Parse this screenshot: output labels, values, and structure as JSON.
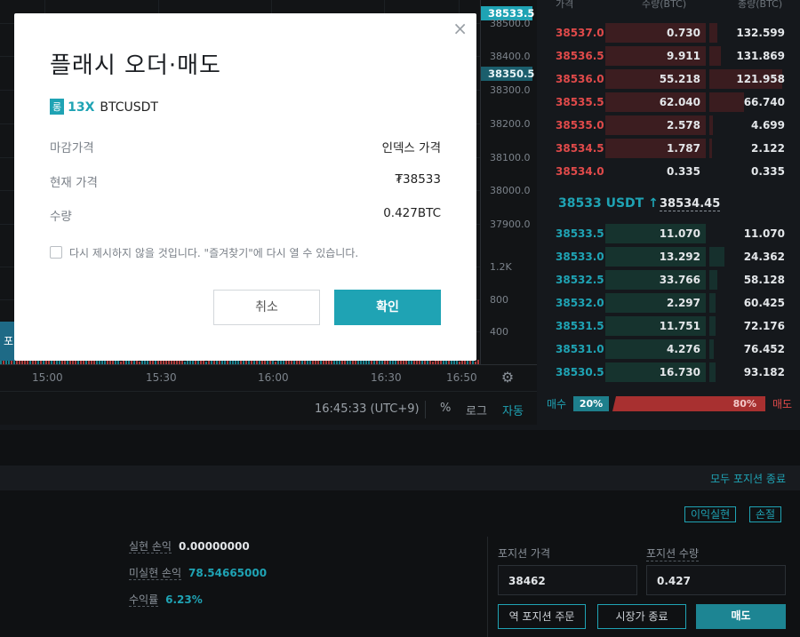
{
  "chart": {
    "price_ticks": [
      "38500.0",
      "38400.0",
      "38300.0",
      "38200.0",
      "38100.0",
      "38000.0",
      "37900.0"
    ],
    "volume_ticks": [
      "1.2K",
      "800",
      "400"
    ],
    "time_ticks": [
      "15:00",
      "15:30",
      "16:00",
      "16:30",
      "16:50"
    ],
    "tag_last": "38533.5",
    "tag_mark": "38350.5",
    "left_button_label": "포",
    "clock": "16:45:33 (UTC+9)",
    "toolbar": {
      "percent": "%",
      "log": "로그",
      "auto": "자동"
    },
    "colors": {
      "up": "#1fa3b4",
      "down": "#e04a4a"
    }
  },
  "orderbook": {
    "headers": {
      "price": "가격",
      "qty": "수량(BTC)",
      "total": "총량(BTC)"
    },
    "asks": [
      {
        "price": "38537.0",
        "qty": "0.730",
        "total": "132.599",
        "depth": 1.0,
        "mini": 0.1
      },
      {
        "price": "38536.5",
        "qty": "9.911",
        "total": "131.869",
        "depth": 1.0,
        "mini": 0.15
      },
      {
        "price": "38536.0",
        "qty": "55.218",
        "total": "121.958",
        "depth": 1.0,
        "mini": 0.95
      },
      {
        "price": "38535.5",
        "qty": "62.040",
        "total": "66.740",
        "depth": 1.0,
        "mini": 0.45
      },
      {
        "price": "38535.0",
        "qty": "2.578",
        "total": "4.699",
        "depth": 1.0,
        "mini": 0.05
      },
      {
        "price": "38534.5",
        "qty": "1.787",
        "total": "2.122",
        "depth": 1.0,
        "mini": 0.03
      },
      {
        "price": "38534.0",
        "qty": "0.335",
        "total": "0.335",
        "depth": 0.0,
        "mini": 0.0
      }
    ],
    "last_price": "38533 USDT",
    "arrow": "↑",
    "mark_price": "38534.45",
    "bids": [
      {
        "price": "38533.5",
        "qty": "11.070",
        "total": "11.070",
        "depth": 1.0,
        "mini": 0.0
      },
      {
        "price": "38533.0",
        "qty": "13.292",
        "total": "24.362",
        "depth": 1.0,
        "mini": 0.2
      },
      {
        "price": "38532.5",
        "qty": "33.766",
        "total": "58.128",
        "depth": 1.0,
        "mini": 0.1
      },
      {
        "price": "38532.0",
        "qty": "2.297",
        "total": "60.425",
        "depth": 1.0,
        "mini": 0.08
      },
      {
        "price": "38531.5",
        "qty": "11.751",
        "total": "72.176",
        "depth": 1.0,
        "mini": 0.08
      },
      {
        "price": "38531.0",
        "qty": "4.276",
        "total": "76.452",
        "depth": 1.0,
        "mini": 0.06
      },
      {
        "price": "38530.5",
        "qty": "16.730",
        "total": "93.182",
        "depth": 1.0,
        "mini": 0.08
      }
    ],
    "ratio": {
      "buy_label": "매수",
      "buy_pct": "20%",
      "sell_pct": "80%",
      "sell_label": "매도",
      "buy_fraction": 0.2
    }
  },
  "bottom": {
    "close_all": "모두 포지션 종료",
    "take_profit": "이익실현",
    "stop_loss": "손절",
    "pnl": [
      {
        "key": "실현 손익",
        "value": "0.00000000",
        "color": "#e3e6e9"
      },
      {
        "key": "미실현 손익",
        "value": "78.54665000",
        "color": "#1fa3b4"
      },
      {
        "key": "수익률",
        "value": "6.23%",
        "color": "#1fa3b4"
      }
    ],
    "position_price_label": "포지션 가격",
    "position_qty_label": "포지션 수량",
    "position_price": "38462",
    "position_qty": "0.427",
    "reverse_btn": "역 포지션 주문",
    "market_close_btn": "시장가 종료",
    "sell_btn": "매도"
  },
  "modal": {
    "title": "플래시 오더·매도",
    "badge": "롱",
    "leverage": "13X",
    "symbol": "BTCUSDT",
    "rows": [
      {
        "key": "마감가격",
        "value": "인덱스 가격"
      },
      {
        "key": "현재 가격",
        "value": "₮38533"
      },
      {
        "key": "수량",
        "value": "0.427BTC"
      }
    ],
    "checkbox_label": "다시 제시하지 않을 것입니다. \"즐겨찾기\"에 다시 열 수 있습니다.",
    "cancel": "취소",
    "confirm": "확인",
    "close_glyph": "×"
  }
}
